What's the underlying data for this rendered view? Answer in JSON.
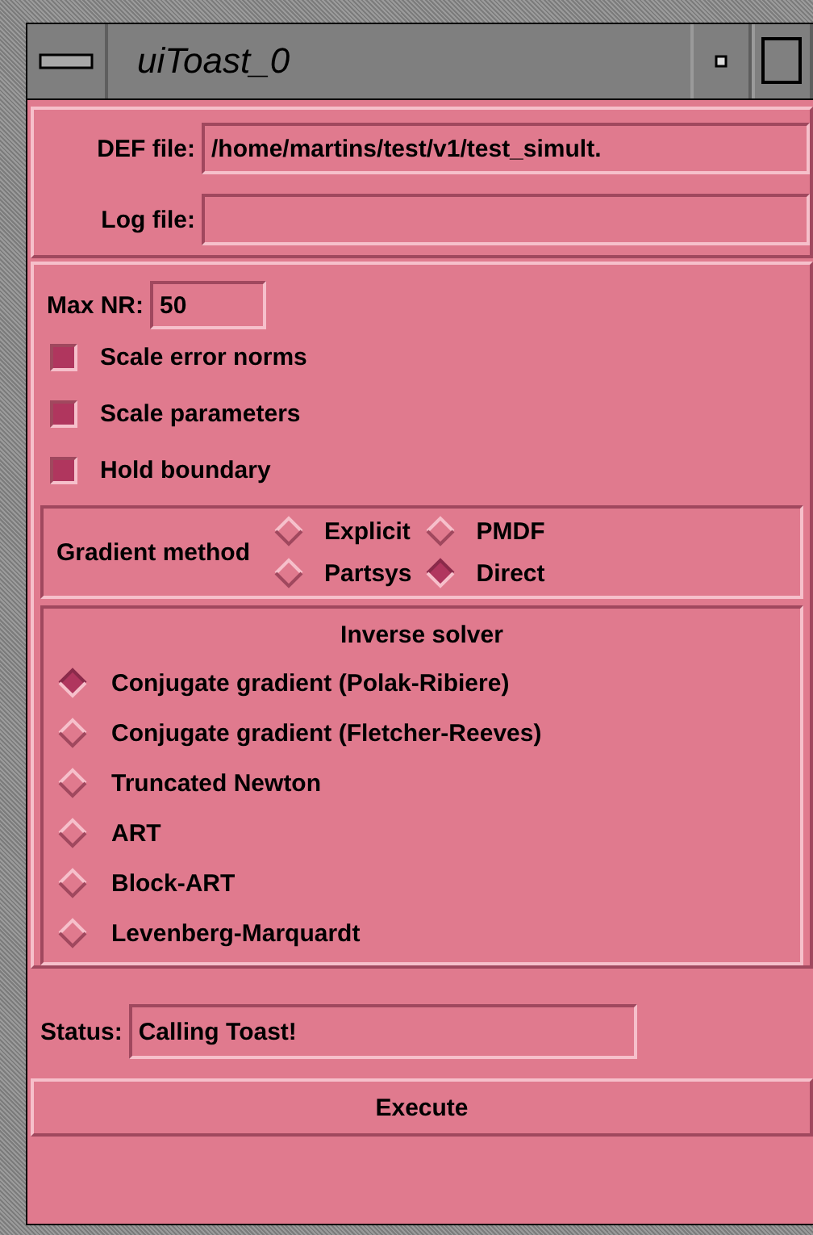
{
  "window": {
    "title": "uiToast_0"
  },
  "files": [
    {
      "label": "DEF file:",
      "value": "/home/martins/test/v1/test_simult."
    },
    {
      "label": "Log file:"
    }
  ],
  "max_nr": {
    "label": "Max NR:",
    "value": "50"
  },
  "options": [
    {
      "label": "Scale error norms",
      "checked": true
    },
    {
      "label": "Scale parameters",
      "checked": true
    },
    {
      "label": "Hold boundary",
      "checked": true
    }
  ],
  "gradient_method": {
    "label": "Gradient method",
    "options": [
      {
        "label": "Explicit",
        "selected": false
      },
      {
        "label": "PMDF",
        "selected": false
      },
      {
        "label": "Partsys",
        "selected": false
      },
      {
        "label": "Direct",
        "selected": true
      }
    ]
  },
  "inverse_solver": {
    "title": "Inverse solver",
    "options": [
      {
        "label": "Conjugate gradient (Polak-Ribiere)",
        "selected": true
      },
      {
        "label": "Conjugate gradient (Fletcher-Reeves)",
        "selected": false
      },
      {
        "label": "Truncated Newton",
        "selected": false
      },
      {
        "label": "ART",
        "selected": false
      },
      {
        "label": "Block-ART",
        "selected": false
      },
      {
        "label": "Levenberg-Marquardt",
        "selected": false
      }
    ]
  },
  "status": {
    "label": "Status:",
    "value": "Calling Toast!"
  },
  "buttons": [
    "Execute"
  ]
}
